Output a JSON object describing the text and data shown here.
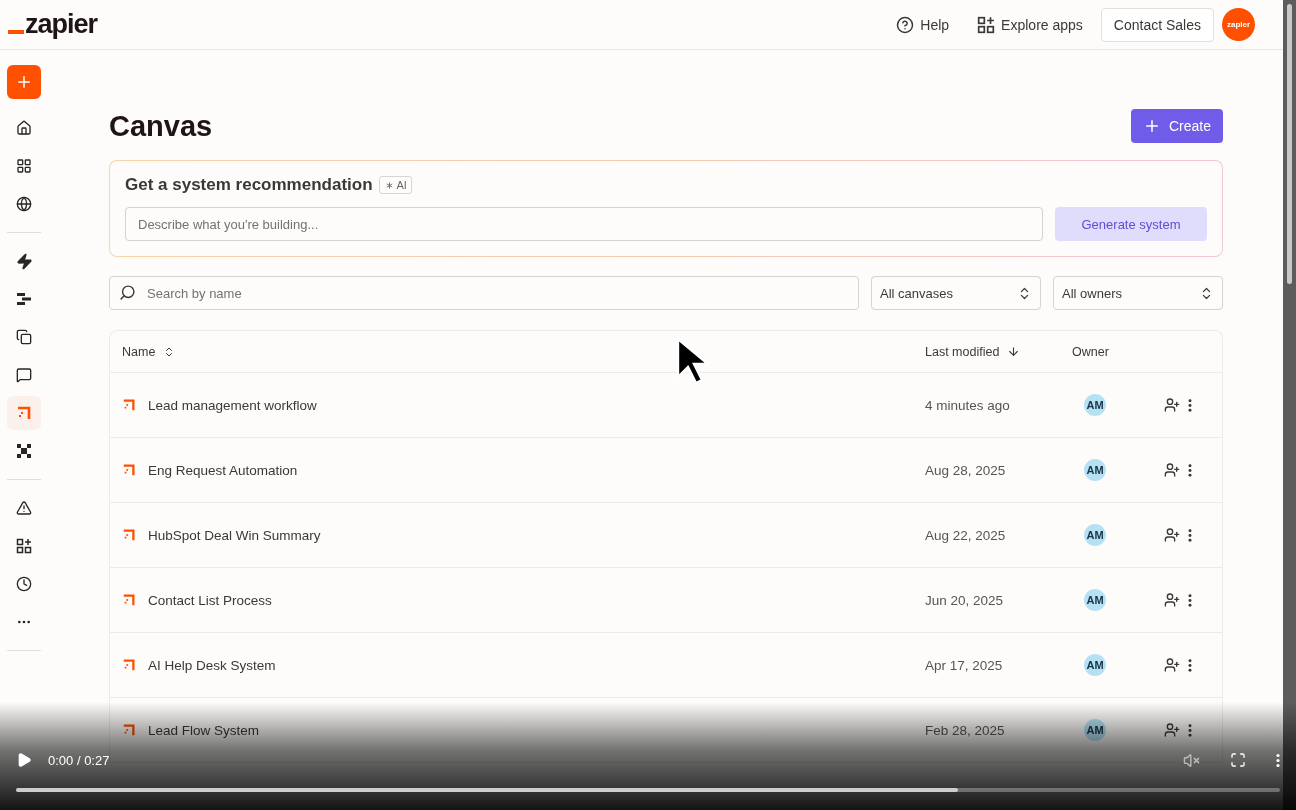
{
  "header": {
    "logo": "zapier",
    "links": [
      {
        "kind": "help",
        "label": "Help"
      },
      {
        "kind": "apps",
        "label": "Explore apps"
      }
    ],
    "contact_button": "Contact Sales",
    "avatar": "zapier"
  },
  "sidebar": {
    "groups": [
      {
        "items": [
          {
            "selected": false
          },
          {
            "selected": false
          },
          {
            "selected": false
          }
        ]
      },
      {
        "items": [
          {
            "selected": false
          },
          {
            "selected": false
          },
          {
            "selected": false
          },
          {
            "selected": false
          },
          {
            "selected": true
          },
          {
            "selected": false
          }
        ]
      },
      {
        "items": [
          {
            "selected": false
          },
          {
            "selected": false
          },
          {
            "selected": false
          },
          {
            "selected": false
          }
        ]
      }
    ]
  },
  "page": {
    "title": "Canvas",
    "create_button": "Create"
  },
  "recommendation": {
    "title": "Get a system recommendation",
    "badge": "AI",
    "placeholder": "Describe what you're building...",
    "button": "Generate system"
  },
  "filters": {
    "search_placeholder": "Search by name",
    "selects": [
      "All canvases",
      "All owners"
    ]
  },
  "table": {
    "columns": [
      "Name",
      "Last modified",
      "Owner"
    ],
    "rows": [
      {
        "name": "Lead management workflow",
        "modified": "4 minutes ago",
        "owner": "AM"
      },
      {
        "name": "Eng Request Automation",
        "modified": "Aug 28, 2025",
        "owner": "AM"
      },
      {
        "name": "HubSpot Deal Win Summary",
        "modified": "Aug 22, 2025",
        "owner": "AM"
      },
      {
        "name": "Contact List Process",
        "modified": "Jun 20, 2025",
        "owner": "AM"
      },
      {
        "name": "AI Help Desk System",
        "modified": "Apr 17, 2025",
        "owner": "AM"
      },
      {
        "name": "Lead Flow System",
        "modified": "Feb 28, 2025",
        "owner": "AM"
      }
    ]
  },
  "player": {
    "time": "0:00 / 0:27",
    "muted": true,
    "progress": {
      "level": 0.745
    }
  }
}
